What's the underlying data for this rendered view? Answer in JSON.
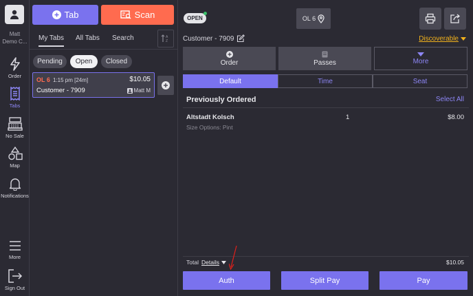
{
  "rail": {
    "user": {
      "name": "Matt",
      "location": "Demo C..."
    },
    "items": [
      {
        "label": "Order",
        "icon": "bolt-icon"
      },
      {
        "label": "Tabs",
        "icon": "receipt-icon"
      },
      {
        "label": "No Sale",
        "icon": "cash-register-icon"
      },
      {
        "label": "Map",
        "icon": "shapes-icon"
      },
      {
        "label": "Notifications",
        "icon": "bell-icon"
      },
      {
        "label": "More",
        "icon": "hamburger-icon"
      },
      {
        "label": "Sign Out",
        "icon": "sign-out-icon"
      }
    ]
  },
  "tabs_panel": {
    "tab_button": "Tab",
    "scan_button": "Scan",
    "subtabs": [
      "My Tabs",
      "All Tabs",
      "Search"
    ],
    "filters": [
      "Pending",
      "Open",
      "Closed"
    ],
    "card": {
      "table": "OL 6",
      "time": "1:15 pm [24m]",
      "amount": "$10.05",
      "customer": "Customer - 7909",
      "server": "Matt M"
    }
  },
  "main": {
    "status": "OPEN",
    "table": "OL 6",
    "customer": "Customer - 7909",
    "discoverable": "Discoverable",
    "actions": [
      "Order",
      "Passes",
      "More"
    ],
    "segments": [
      "Default",
      "Time",
      "Seat"
    ],
    "section_title": "Previously Ordered",
    "select_all": "Select All",
    "item": {
      "name": "Altstadt Kolsch",
      "qty": "1",
      "price": "$8.00",
      "modifier": "Size Options: Pint"
    },
    "total_label": "Total",
    "details_label": "Details",
    "total": "$10.05",
    "buttons": [
      "Auth",
      "Split Pay",
      "Pay"
    ]
  },
  "colors": {
    "accent": "#7a72ee",
    "scan": "#ff6b4f",
    "discoverable": "#f2b21c",
    "table_label": "#ff6b4f",
    "open_dot": "#3ac06a"
  }
}
